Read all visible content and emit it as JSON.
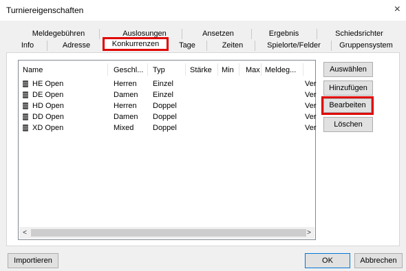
{
  "window": {
    "title": "Turniereigenschaften",
    "close_label": "×"
  },
  "tabs": {
    "row1": [
      "Meldegebühren",
      "Auslosungen",
      "Ansetzen",
      "Ergebnis",
      "Schiedsrichter"
    ],
    "row2": [
      "Info",
      "Adresse",
      "Konkurrenzen",
      "Tage",
      "Zeiten",
      "Spielorte/Felder",
      "Gruppensystem"
    ],
    "selected": "Konkurrenzen"
  },
  "list": {
    "columns": [
      "Name",
      "Geschl...",
      "Typ",
      "Stärke",
      "Min",
      "Max",
      "Meldeg..."
    ],
    "rows": [
      {
        "name": "HE Open",
        "gender": "Herren",
        "type": "Einzel",
        "trail": "Ver"
      },
      {
        "name": "DE Open",
        "gender": "Damen",
        "type": "Einzel",
        "trail": "Ver"
      },
      {
        "name": "HD Open",
        "gender": "Herren",
        "type": "Doppel",
        "trail": "Ver"
      },
      {
        "name": "DD Open",
        "gender": "Damen",
        "type": "Doppel",
        "trail": "Ver"
      },
      {
        "name": "XD Open",
        "gender": "Mixed",
        "type": "Doppel",
        "trail": "Ver"
      }
    ],
    "scroll_left": "<",
    "scroll_right": ">"
  },
  "side_buttons": {
    "select": "Auswählen",
    "add": "Hinzufügen",
    "edit": "Bearbeiten",
    "delete": "Löschen"
  },
  "footer": {
    "import": "Importieren",
    "ok": "OK",
    "cancel": "Abbrechen"
  },
  "colors": {
    "highlight": "#e00000",
    "focus_border": "#0078d7"
  }
}
